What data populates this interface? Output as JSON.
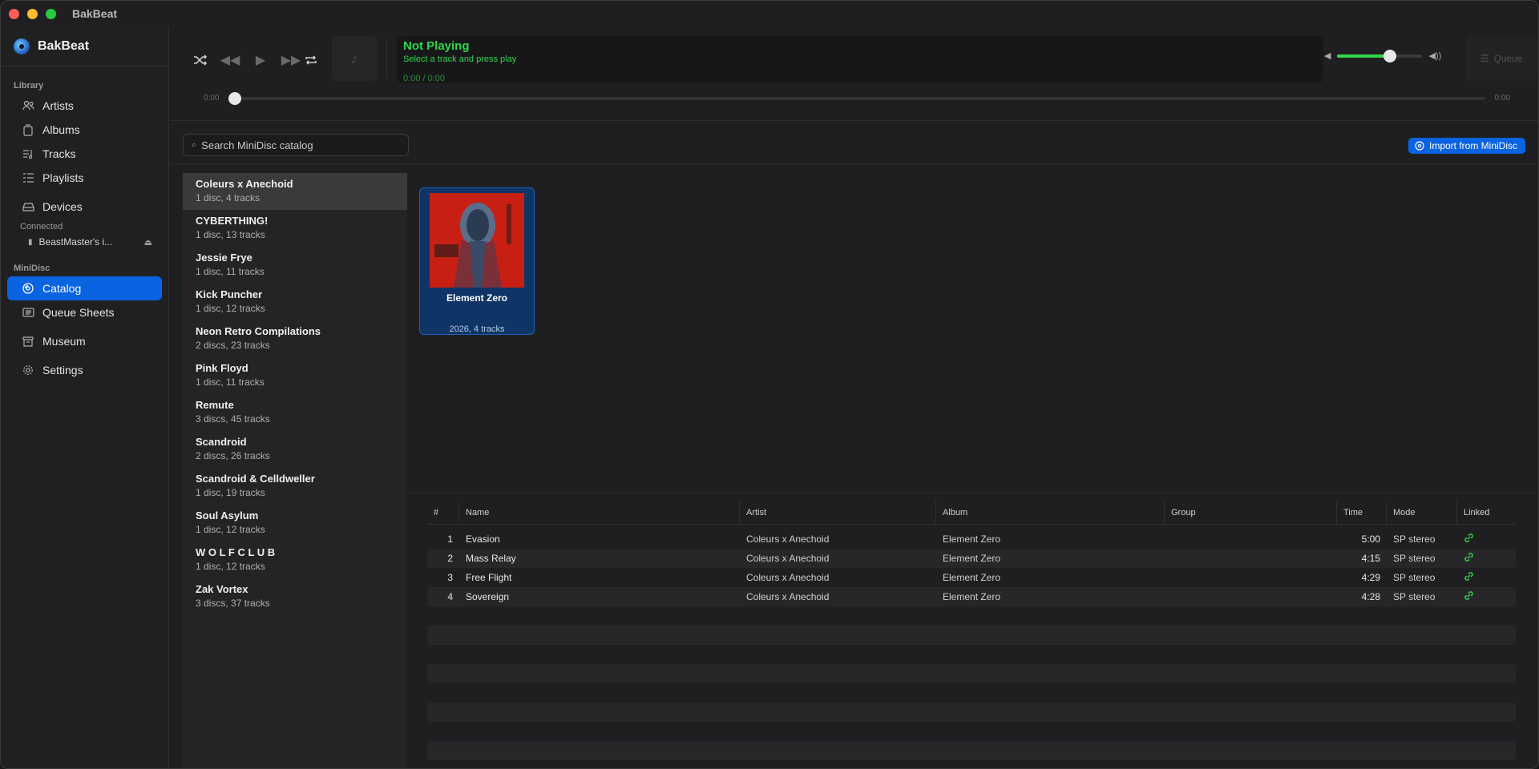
{
  "window": {
    "title": "BakBeat"
  },
  "sidebar": {
    "brand": "BakBeat",
    "library_label": "Library",
    "library_items": [
      {
        "label": "Artists",
        "icon": "people-icon"
      },
      {
        "label": "Albums",
        "icon": "album-icon"
      },
      {
        "label": "Tracks",
        "icon": "tracks-icon"
      },
      {
        "label": "Playlists",
        "icon": "playlist-icon"
      }
    ],
    "devices_label": "Devices",
    "connected_label": "Connected",
    "device_name": "BeastMaster's i...",
    "minidisc_label": "MiniDisc",
    "minidisc_items": [
      {
        "label": "Catalog",
        "icon": "catalog-icon",
        "active": true
      },
      {
        "label": "Queue Sheets",
        "icon": "sheet-icon"
      }
    ],
    "museum_label": "Museum",
    "settings_label": "Settings"
  },
  "player": {
    "status": "Not Playing",
    "hint": "Select a track and press play",
    "time": "0:00 / 0:00",
    "elapsed": "0:00",
    "remaining": "0:00",
    "volume_level": 0.62,
    "queue_label": "Queue"
  },
  "toolbar": {
    "search_placeholder": "Search MiniDisc catalog",
    "import_label": "Import from MiniDisc"
  },
  "artists": [
    {
      "name": "Coleurs x Anechoid",
      "meta": "1 disc, 4 tracks",
      "selected": true
    },
    {
      "name": "CYBERTHING!",
      "meta": "1 disc, 13 tracks"
    },
    {
      "name": "Jessie Frye",
      "meta": "1 disc, 11 tracks"
    },
    {
      "name": "Kick Puncher",
      "meta": "1 disc, 12 tracks"
    },
    {
      "name": "Neon Retro Compilations",
      "meta": "2 discs, 23 tracks"
    },
    {
      "name": "Pink Floyd",
      "meta": "1 disc, 11 tracks"
    },
    {
      "name": "Remute",
      "meta": "3 discs, 45 tracks"
    },
    {
      "name": "Scandroid",
      "meta": "2 discs, 26 tracks"
    },
    {
      "name": "Scandroid & Celldweller",
      "meta": "1 disc, 19 tracks"
    },
    {
      "name": "Soul Asylum",
      "meta": "1 disc, 12 tracks"
    },
    {
      "name": "W O L F C L U B",
      "meta": "1 disc, 12 tracks"
    },
    {
      "name": "Zak Vortex",
      "meta": "3 discs, 37 tracks"
    }
  ],
  "album": {
    "title": "Element Zero",
    "meta": "2026, 4 tracks"
  },
  "track_table": {
    "headers": [
      "#",
      "Name",
      "Artist",
      "Album",
      "Group",
      "Time",
      "Mode",
      "Linked"
    ],
    "rows": [
      {
        "num": "1",
        "name": "Evasion",
        "artist": "Coleurs x Anechoid",
        "album": "Element Zero",
        "group": "",
        "time": "5:00",
        "mode": "SP stereo"
      },
      {
        "num": "2",
        "name": "Mass Relay",
        "artist": "Coleurs x Anechoid",
        "album": "Element Zero",
        "group": "",
        "time": "4:15",
        "mode": "SP stereo"
      },
      {
        "num": "3",
        "name": "Free Flight",
        "artist": "Coleurs x Anechoid",
        "album": "Element Zero",
        "group": "",
        "time": "4:29",
        "mode": "SP stereo"
      },
      {
        "num": "4",
        "name": "Sovereign",
        "artist": "Coleurs x Anechoid",
        "album": "Element Zero",
        "group": "",
        "time": "4:28",
        "mode": "SP stereo"
      }
    ]
  },
  "colors": {
    "accent": "#0a63e0",
    "playing_green": "#32d74b"
  }
}
